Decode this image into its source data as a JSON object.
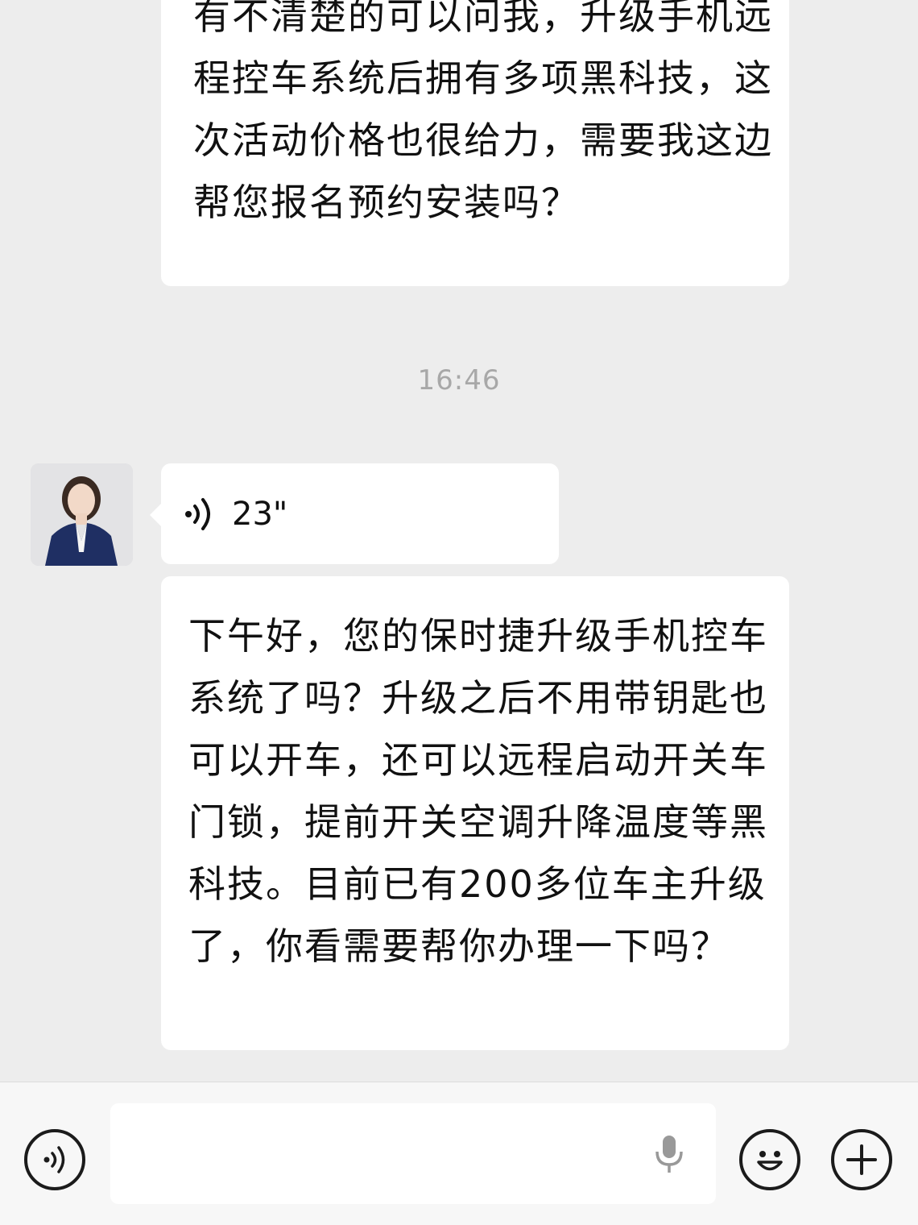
{
  "messages": {
    "first_text": "有不清楚的可以问我，升级手机远程控车系统后拥有多项黑科技，这次活动价格也很给力，需要我这边帮您报名预约安装吗？",
    "timestamp": "16:46",
    "voice_duration": "23\"",
    "second_text": "下午好，您的保时捷升级手机控车系统了吗？升级之后不用带钥匙也可以开车，还可以远程启动开关车门锁，提前开关空调升降温度等黑科技。目前已有200多位车主升级了，你看需要帮你办理一下吗？"
  },
  "icons": {
    "voice_message": "voice-wave-icon",
    "voice_toggle": "voice-mode-icon",
    "mic": "microphone-icon",
    "emoji": "emoji-icon",
    "plus": "plus-icon"
  },
  "colors": {
    "background": "#ededed",
    "bubble": "#ffffff",
    "timestamp": "#a8a8a8",
    "toolbar": "#f7f7f7"
  }
}
